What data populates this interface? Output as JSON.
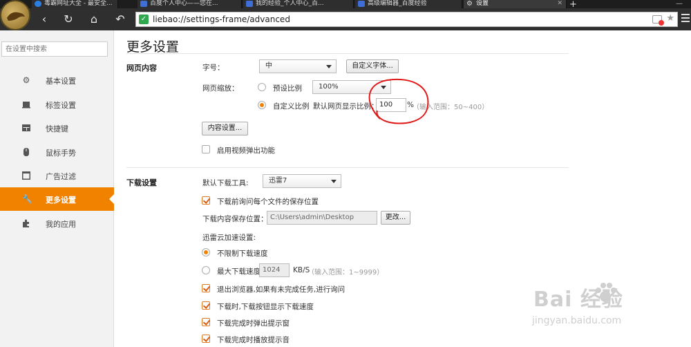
{
  "tabs": [
    {
      "label": "毒霸网址大全 - 最安全..."
    },
    {
      "label": "百度个人中心——您在..."
    },
    {
      "label": "我的经验_个人中心_百..."
    },
    {
      "label": "高级编辑器_百度经验"
    },
    {
      "label": "设置"
    }
  ],
  "toolbar": {
    "back": "‹",
    "refresh": "↻",
    "home": "⌂",
    "undo": "↶"
  },
  "address": {
    "url": "liebao://settings-frame/advanced"
  },
  "sidebar": {
    "search_placeholder": "在设置中搜索",
    "items": [
      {
        "label": "基本设置",
        "icon": "gear-icon"
      },
      {
        "label": "标签设置",
        "icon": "tab-icon"
      },
      {
        "label": "快捷键",
        "icon": "keyboard-icon"
      },
      {
        "label": "鼠标手势",
        "icon": "mouse-icon"
      },
      {
        "label": "广告过滤",
        "icon": "window-icon"
      },
      {
        "label": "更多设置",
        "icon": "wrench-icon",
        "active": true
      },
      {
        "label": "我的应用",
        "icon": "puzzle-icon"
      }
    ]
  },
  "main": {
    "title": "更多设置",
    "web": {
      "section": "网页内容",
      "font_size_label": "字号：",
      "font_size_value": "中",
      "custom_font_button": "自定义字体...",
      "zoom_label": "网页缩放：",
      "preset_label": "预设比例",
      "preset_value": "100%",
      "custom_label": "自定义比例",
      "custom_desc": "默认网页显示比例：",
      "custom_value": "100",
      "custom_unit": "%",
      "custom_hint": "（输入范围：50~400）",
      "content_button": "内容设置...",
      "video_popup": "启用视频弹出功能"
    },
    "download": {
      "section": "下载设置",
      "tool_label": "默认下载工具:",
      "tool_value": "迅雷7",
      "ask_location": "下载前询问每个文件的保存位置",
      "path_label": "下载内容保存位置：",
      "path_value": "C:\\Users\\admin\\Desktop",
      "change_button": "更改...",
      "cloud_label": "迅雷云加速设置:",
      "unlimited": "不限制下载速度",
      "max_label": "最大下载速度:",
      "max_value": "1024",
      "max_unit": "KB/S",
      "max_hint": "（输入范围：1~9999）",
      "exit_ask": "退出浏览器,如果有未完成任务,进行询问",
      "show_speed": "下载时,下载按钮显示下载速度",
      "popup_done": "下载完成时弹出提示窗",
      "sound_done": "下载完成时播放提示音"
    }
  },
  "watermark": {
    "text": "Bai 经验",
    "sub": "jingyan.baidu.com"
  },
  "colors": {
    "accent": "#f08200",
    "annotation": "#e01818"
  }
}
